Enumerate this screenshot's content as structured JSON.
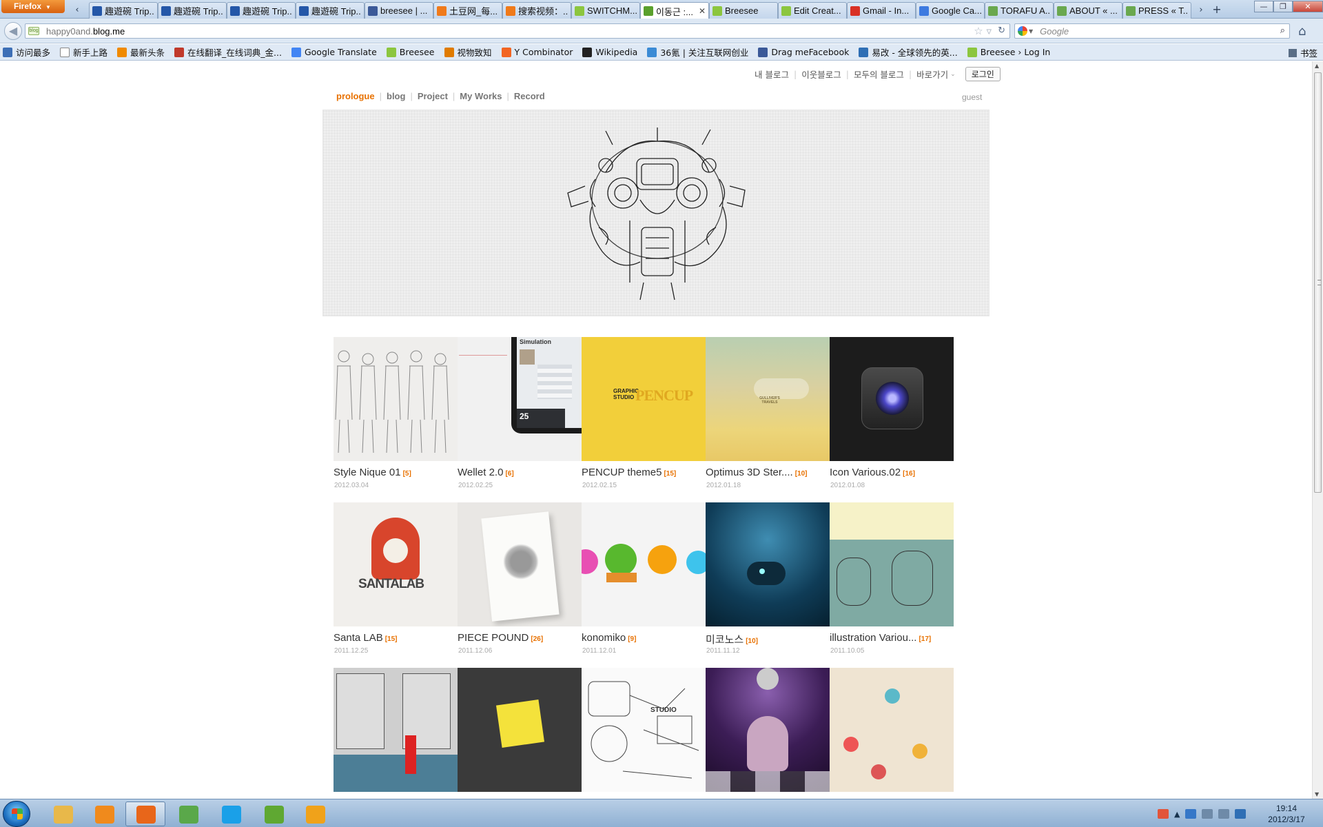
{
  "browser": {
    "app_menu_label": "Firefox",
    "tabs": [
      {
        "label": "趣遊碗 Trip...",
        "icon": "circle-icon",
        "color": "#2457a8"
      },
      {
        "label": "趣遊碗 Trip...",
        "icon": "circle-icon",
        "color": "#2457a8"
      },
      {
        "label": "趣遊碗 Trip...",
        "icon": "circle-icon",
        "color": "#2457a8"
      },
      {
        "label": "趣遊碗 Trip...",
        "icon": "circle-icon",
        "color": "#2457a8"
      },
      {
        "label": "breesee | ...",
        "icon": "facebook-icon",
        "color": "#3b5998"
      },
      {
        "label": "土豆网_每...",
        "icon": "tudou-icon",
        "color": "#f07a1a"
      },
      {
        "label": "搜索视频：...",
        "icon": "tudou-icon",
        "color": "#f07a1a"
      },
      {
        "label": "SWITCHM...",
        "icon": "leaf-icon",
        "color": "#8cc63f"
      },
      {
        "label": "이동근 :...",
        "icon": "blog-icon",
        "color": "#5aa02c",
        "active": true
      },
      {
        "label": "Breesee",
        "icon": "leaf-icon",
        "color": "#8cc63f"
      },
      {
        "label": "Edit Creat...",
        "icon": "leaf-icon",
        "color": "#8cc63f"
      },
      {
        "label": "Gmail - In...",
        "icon": "gmail-icon",
        "color": "#d93025"
      },
      {
        "label": "Google Ca...",
        "icon": "calendar-icon",
        "color": "#3d7ae0"
      },
      {
        "label": "TORAFU A...",
        "icon": "grid-icon",
        "color": "#6aa84f"
      },
      {
        "label": "ABOUT « ...",
        "icon": "grid-icon",
        "color": "#6aa84f"
      },
      {
        "label": "PRESS « T...",
        "icon": "grid-icon",
        "color": "#6aa84f"
      }
    ],
    "url_prefix": "happy0and.",
    "url_host": "blog.me",
    "search_placeholder": "Google",
    "bookmarks": [
      {
        "label": "访问最多",
        "icon": "bookmark-icon",
        "color": "#3d6fb6"
      },
      {
        "label": "新手上路",
        "icon": "page-icon",
        "color": "#ffffff"
      },
      {
        "label": "最新头条",
        "icon": "rss-icon",
        "color": "#f08a00"
      },
      {
        "label": "在线翻译_在线词典_金...",
        "icon": "dict-icon",
        "color": "#c0392b"
      },
      {
        "label": "Google Translate",
        "icon": "translate-icon",
        "color": "#4285f4"
      },
      {
        "label": "Breesee",
        "icon": "leaf-icon",
        "color": "#8cc63f"
      },
      {
        "label": "视物致知",
        "icon": "view-icon",
        "color": "#e07b00"
      },
      {
        "label": "Y Combinator",
        "icon": "ycombinator-icon",
        "color": "#f26522"
      },
      {
        "label": "Wikipedia",
        "icon": "wikipedia-icon",
        "color": "#222222"
      },
      {
        "label": "36氪 | 关注互联网创业",
        "icon": "kr-icon",
        "color": "#3b8bd5"
      },
      {
        "label": "Drag meFacebook",
        "icon": "facebook-icon",
        "color": "#3b5998"
      },
      {
        "label": "易改 - 全球领先的英...",
        "icon": "check-icon",
        "color": "#2f6fb5"
      },
      {
        "label": "Breesee › Log In",
        "icon": "leaf-icon",
        "color": "#8cc63f"
      }
    ],
    "bookmarks_folder_label": "书签"
  },
  "blog": {
    "top_links": [
      "내 블로그",
      "이웃블로그",
      "모두의 블로그",
      "바로가기"
    ],
    "login_label": "로그인",
    "nav": [
      "prologue",
      "blog",
      "Project",
      "My Works",
      "Record"
    ],
    "user_label": "guest",
    "accent_color": "#e87100",
    "posts": [
      {
        "title": "Style Nique 01",
        "count": "[5]",
        "date": "2012.03.04",
        "art": "sketch-figures"
      },
      {
        "title": "Wellet 2.0",
        "count": "[6]",
        "date": "2012.02.25",
        "art": "ipad-app",
        "mini_title": "Simulation",
        "mini_days": "25"
      },
      {
        "title": "PENCUP theme5",
        "count": "[15]",
        "date": "2012.02.15",
        "art": "pencup",
        "mini_logo": "GRAPHIC STUDIO",
        "mini_word": "PENCUP"
      },
      {
        "title": "Optimus 3D Ster....",
        "count": "[10]",
        "date": "2012.01.18",
        "art": "gulliver",
        "mini_text": "GULLIVER'S TRAVELS"
      },
      {
        "title": "Icon Various.02",
        "count": "[16]",
        "date": "2012.01.08",
        "art": "camera-icon"
      },
      {
        "title": "Santa LAB",
        "count": "[15]",
        "date": "2011.12.25",
        "art": "santa",
        "mini_text": "SANTALAB"
      },
      {
        "title": "PIECE POUND",
        "count": "[26]",
        "date": "2011.12.06",
        "art": "book"
      },
      {
        "title": "konomiko",
        "count": "[9]",
        "date": "2011.12.01",
        "art": "characters"
      },
      {
        "title": "미코노스",
        "count": "[10]",
        "date": "2011.11.12",
        "art": "underwater"
      },
      {
        "title": "illustration Variou...",
        "count": "[17]",
        "date": "2011.10.05",
        "art": "teal-illustration"
      },
      {
        "title": "",
        "count": "",
        "date": "",
        "art": "street-posters"
      },
      {
        "title": "",
        "count": "",
        "date": "",
        "art": "sticky-note"
      },
      {
        "title": "",
        "count": "",
        "date": "",
        "art": "sketch-machine",
        "mini_text": "STUDIO"
      },
      {
        "title": "",
        "count": "",
        "date": "",
        "art": "disco"
      },
      {
        "title": "",
        "count": "",
        "date": "",
        "art": "doodles"
      }
    ]
  },
  "taskbar": {
    "apps": [
      {
        "name": "explorer",
        "icon": "folder-icon",
        "color": "#e8b84a"
      },
      {
        "name": "media-player",
        "icon": "media-player-icon",
        "color": "#f08a1c"
      },
      {
        "name": "firefox",
        "icon": "firefox-icon",
        "color": "#e8661a",
        "open": true
      },
      {
        "name": "messenger",
        "icon": "messenger-icon",
        "color": "#5aa84a"
      },
      {
        "name": "skype",
        "icon": "skype-icon",
        "color": "#1aa0e8"
      },
      {
        "name": "evernote",
        "icon": "evernote-icon",
        "color": "#5fa832"
      },
      {
        "name": "player",
        "icon": "player-icon",
        "color": "#f0a21a"
      }
    ],
    "time": "19:14",
    "date": "2012/3/17"
  }
}
